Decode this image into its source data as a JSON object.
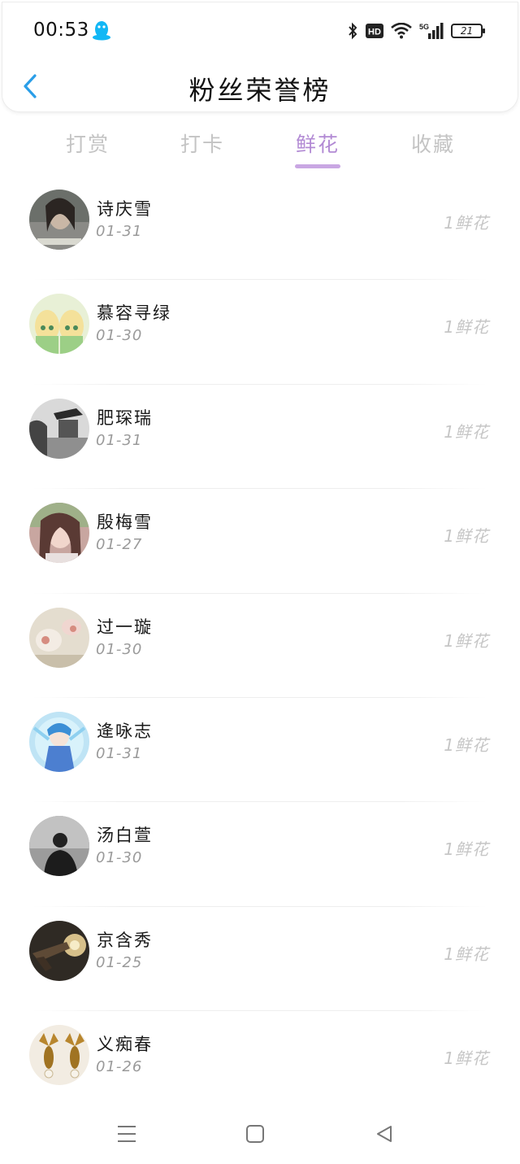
{
  "status_bar": {
    "time": "00:53",
    "battery": "21",
    "network": "5G",
    "hd": "HD"
  },
  "header": {
    "title": "粉丝荣誉榜"
  },
  "tabs": [
    {
      "label": "打赏",
      "active": false
    },
    {
      "label": "打卡",
      "active": false
    },
    {
      "label": "鲜花",
      "active": true
    },
    {
      "label": "收藏",
      "active": false
    }
  ],
  "fans": [
    {
      "name": "诗庆雪",
      "date": "01-31",
      "amount": "1鲜花"
    },
    {
      "name": "慕容寻绿",
      "date": "01-30",
      "amount": "1鲜花"
    },
    {
      "name": "肥琛瑞",
      "date": "01-31",
      "amount": "1鲜花"
    },
    {
      "name": "殷梅雪",
      "date": "01-27",
      "amount": "1鲜花"
    },
    {
      "name": "过一璇",
      "date": "01-30",
      "amount": "1鲜花"
    },
    {
      "name": "逄咏志",
      "date": "01-31",
      "amount": "1鲜花"
    },
    {
      "name": "汤白萱",
      "date": "01-30",
      "amount": "1鲜花"
    },
    {
      "name": "京含秀",
      "date": "01-25",
      "amount": "1鲜花"
    },
    {
      "name": "义痴春",
      "date": "01-26",
      "amount": "1鲜花"
    }
  ],
  "colors": {
    "accent": "#b28ad4",
    "indicator": "#c9a7e3",
    "back_arrow": "#2a9ee8",
    "inactive_tab": "#c4c4c4",
    "date": "#9a9a9a",
    "amount": "#c6c6c6"
  },
  "icons": {
    "back": "chevron-left-icon",
    "qq": "qq-penguin-icon",
    "bluetooth": "bluetooth-icon",
    "wifi": "wifi-icon",
    "signal": "signal-icon",
    "menu": "menu-icon",
    "home": "home-icon",
    "back_nav": "back-triangle-icon"
  }
}
